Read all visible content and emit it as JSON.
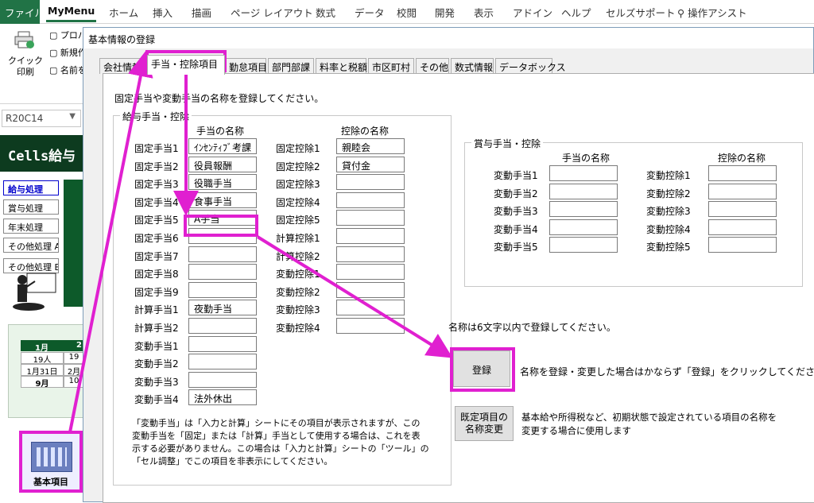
{
  "ribbon": {
    "tabs": [
      "ファイル",
      "MyMenu",
      "ホーム",
      "挿入",
      "描画",
      "ページ レイアウト",
      "数式",
      "データ",
      "校閲",
      "開発",
      "表示",
      "アドイン",
      "ヘルプ",
      "セルズサポート",
      "操作アシスト"
    ],
    "quick_print": "クイック\n印刷",
    "items": [
      "プロパ",
      "新規作",
      "名前を"
    ]
  },
  "sheet": {
    "namebox": "R20C14",
    "banner": "Cells給与",
    "buttons": [
      "給与処理",
      "賞与処理",
      "年末処理",
      "その他処理 A",
      "その他処理 B"
    ],
    "calendar": {
      "head": [
        "1月",
        "2"
      ],
      "rows": [
        [
          "19人",
          "19"
        ],
        [
          "1月31日",
          "2月"
        ],
        [
          "9月",
          "10"
        ]
      ]
    },
    "shortcut_label": "基本項目"
  },
  "dialog": {
    "title": "基本情報の登録",
    "tabs": [
      "会社情報",
      "手当・控除項目",
      "勤怠項目",
      "部門部課",
      "料率と税額",
      "市区町村",
      "その他",
      "数式情報",
      "データボックス"
    ],
    "active_tab": 1,
    "instruction": "固定手当や変動手当の名称を登録してください。",
    "salary_group": {
      "title": "給与手当・控除",
      "allow_header": "手当の名称",
      "deduct_header": "控除の名称",
      "allowances": [
        {
          "label": "固定手当1",
          "value": "ｲﾝｾﾝﾃｨﾌﾞ考課"
        },
        {
          "label": "固定手当2",
          "value": "役員報酬"
        },
        {
          "label": "固定手当3",
          "value": "役職手当"
        },
        {
          "label": "固定手当4",
          "value": "食事手当"
        },
        {
          "label": "固定手当5",
          "value": "A手当"
        },
        {
          "label": "固定手当6",
          "value": ""
        },
        {
          "label": "固定手当7",
          "value": ""
        },
        {
          "label": "固定手当8",
          "value": ""
        },
        {
          "label": "固定手当9",
          "value": ""
        },
        {
          "label": "計算手当1",
          "value": "夜勤手当"
        },
        {
          "label": "計算手当2",
          "value": ""
        },
        {
          "label": "変動手当1",
          "value": ""
        },
        {
          "label": "変動手当2",
          "value": ""
        },
        {
          "label": "変動手当3",
          "value": ""
        },
        {
          "label": "変動手当4",
          "value": "法外休出"
        }
      ],
      "deductions": [
        {
          "label": "固定控除1",
          "value": "親睦会"
        },
        {
          "label": "固定控除2",
          "value": "貸付金"
        },
        {
          "label": "固定控除3",
          "value": ""
        },
        {
          "label": "固定控除4",
          "value": ""
        },
        {
          "label": "固定控除5",
          "value": ""
        },
        {
          "label": "計算控除1",
          "value": ""
        },
        {
          "label": "計算控除2",
          "value": ""
        },
        {
          "label": "変動控除1",
          "value": ""
        },
        {
          "label": "変動控除2",
          "value": ""
        },
        {
          "label": "変動控除3",
          "value": ""
        },
        {
          "label": "変動控除4",
          "value": ""
        }
      ]
    },
    "bonus_group": {
      "title": "賞与手当・控除",
      "allow_header": "手当の名称",
      "deduct_header": "控除の名称",
      "allowances": [
        "変動手当1",
        "変動手当2",
        "変動手当3",
        "変動手当4",
        "変動手当5"
      ],
      "deductions": [
        "変動控除1",
        "変動控除2",
        "変動控除3",
        "変動控除4",
        "変動控除5"
      ]
    },
    "name_limit_note": "名称は6文字以内で登録してください。",
    "register_button": "登録",
    "register_note": "名称を登録・変更した場合はかならず「登録」をクリックしてください",
    "default_button": "既定項目の\n名称変更",
    "default_note": "基本給や所得税など、初期状態で設定されている項目の名称を\n変更する場合に使用します",
    "bottom_note": "「変動手当」は「入力と計算」シートにその項目が表示されますが、この\n変動手当を「固定」または「計算」手当として使用する場合は、これを表\n示する必要がありません。この場合は「入力と計算」シートの「ツール」の\n「セル調整」でこの項目を非表示にしてください。"
  },
  "colors": {
    "highlight": "#e020d0",
    "excel_green": "#217346"
  }
}
